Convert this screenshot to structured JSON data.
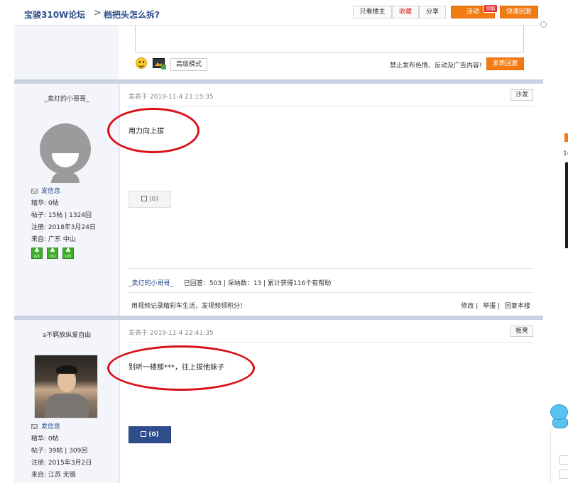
{
  "header": {
    "forum_name": "宝骏310W论坛",
    "separator": ">",
    "thread_title": "档把头怎么拆?",
    "btn_author_only": "只看楼主",
    "btn_favorite": "收藏",
    "btn_share": "分享",
    "btn_activity": "活动",
    "badge_claim": "领取",
    "btn_quick_reply": "快速回复"
  },
  "editor": {
    "advanced_mode": "高级模式",
    "notice": "禁止发布色情、反动及广告内容!",
    "publish": "发表回复"
  },
  "posts": [
    {
      "username": "_卖灯的小哥哥_",
      "date": "发表于 2019-11-4 21:15:35",
      "floor": "沙发",
      "content": "用力向上拔",
      "like": "(0)",
      "send_msg": "发信息",
      "essence": "精华:  0帖",
      "posts": "帖子:  15帖 | 1324回",
      "registered": "注册:  2018年3月24日",
      "from": "来自:  广东 中山",
      "levels": [
        "LV1",
        "LV2",
        "LV3"
      ],
      "stats_user": "_卖灯的小哥哥_",
      "stats_text": "已回答：503  |  采纳数：13  |  累计获得116个有帮助",
      "signature": "用视频记录精彩车生活，发视频领积分！",
      "act_edit": "修改",
      "act_report": "举报",
      "act_reply": "回复本楼"
    },
    {
      "username": "a不羁放纵爱自由",
      "date": "发表于 2019-11-4 22:41:35",
      "floor": "板凳",
      "content": "别听一楼那***，往上拔他妹子",
      "like": "(0)",
      "send_msg": "发信息",
      "essence": "精华:  0帖",
      "posts": "帖子:  39帖 | 309回",
      "registered": "注册:  2015年3月2日",
      "from": "来自:  江苏 无锡"
    }
  ],
  "right_edge": {
    "num": "1("
  }
}
